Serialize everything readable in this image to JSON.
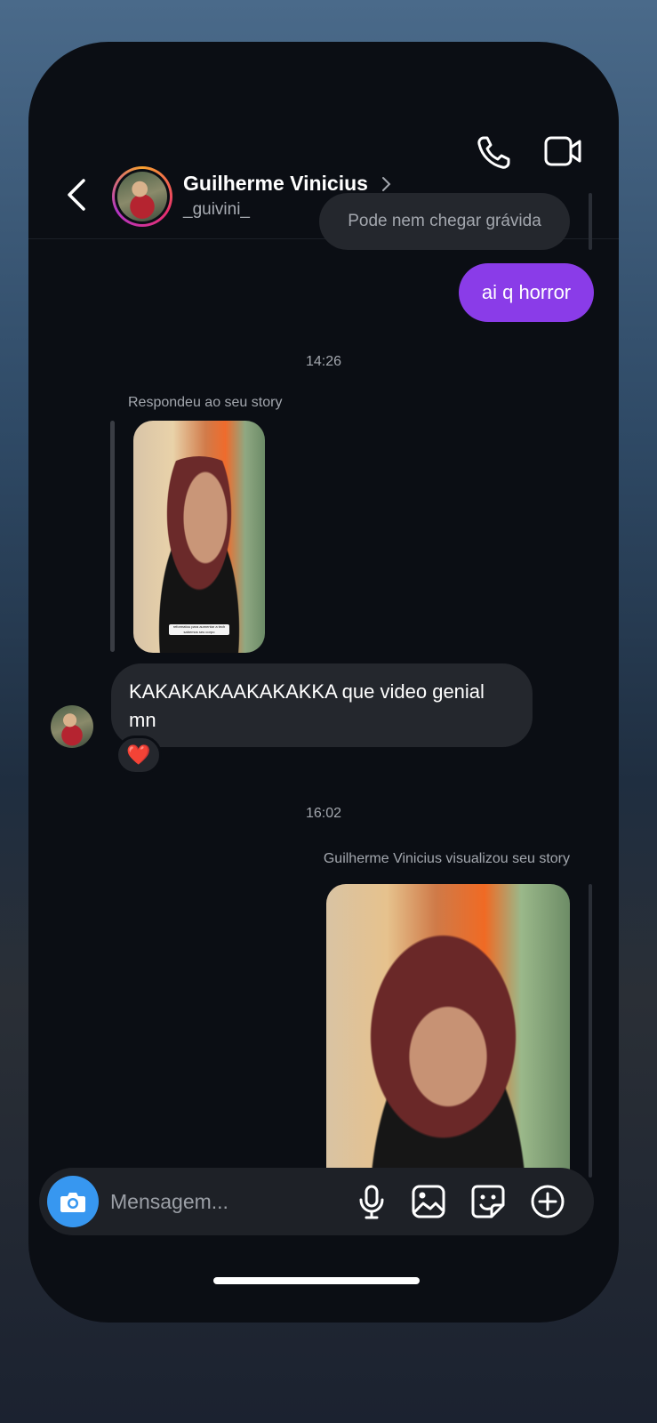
{
  "header": {
    "contact_name": "Guilherme Vinicius",
    "contact_username": "_guivini_"
  },
  "messages": {
    "outgoing_gray": "Pode nem chegar grávida",
    "outgoing_purple": "ai q horror",
    "timestamp_1": "14:26",
    "reply_label": "Respondeu ao seu story",
    "story_caption": "reformatou para aumentar a tech sabemos seu corpo",
    "incoming_text": "KAKAKAKAAKAKAKKA que video genial mn",
    "reaction": "❤️",
    "timestamp_2": "16:02",
    "viewed_label": "Guilherme Vinicius visualizou seu story"
  },
  "composer": {
    "placeholder": "Mensagem..."
  },
  "colors": {
    "background": "#0b0e14",
    "bubble_gray": "#24272d",
    "bubble_purple": "#8a3ce8",
    "camera_blue": "#3797f0"
  },
  "icons": [
    "back-icon",
    "chevron-right-icon",
    "phone-icon",
    "video-icon",
    "camera-icon",
    "microphone-icon",
    "gallery-icon",
    "sticker-icon",
    "plus-icon"
  ]
}
